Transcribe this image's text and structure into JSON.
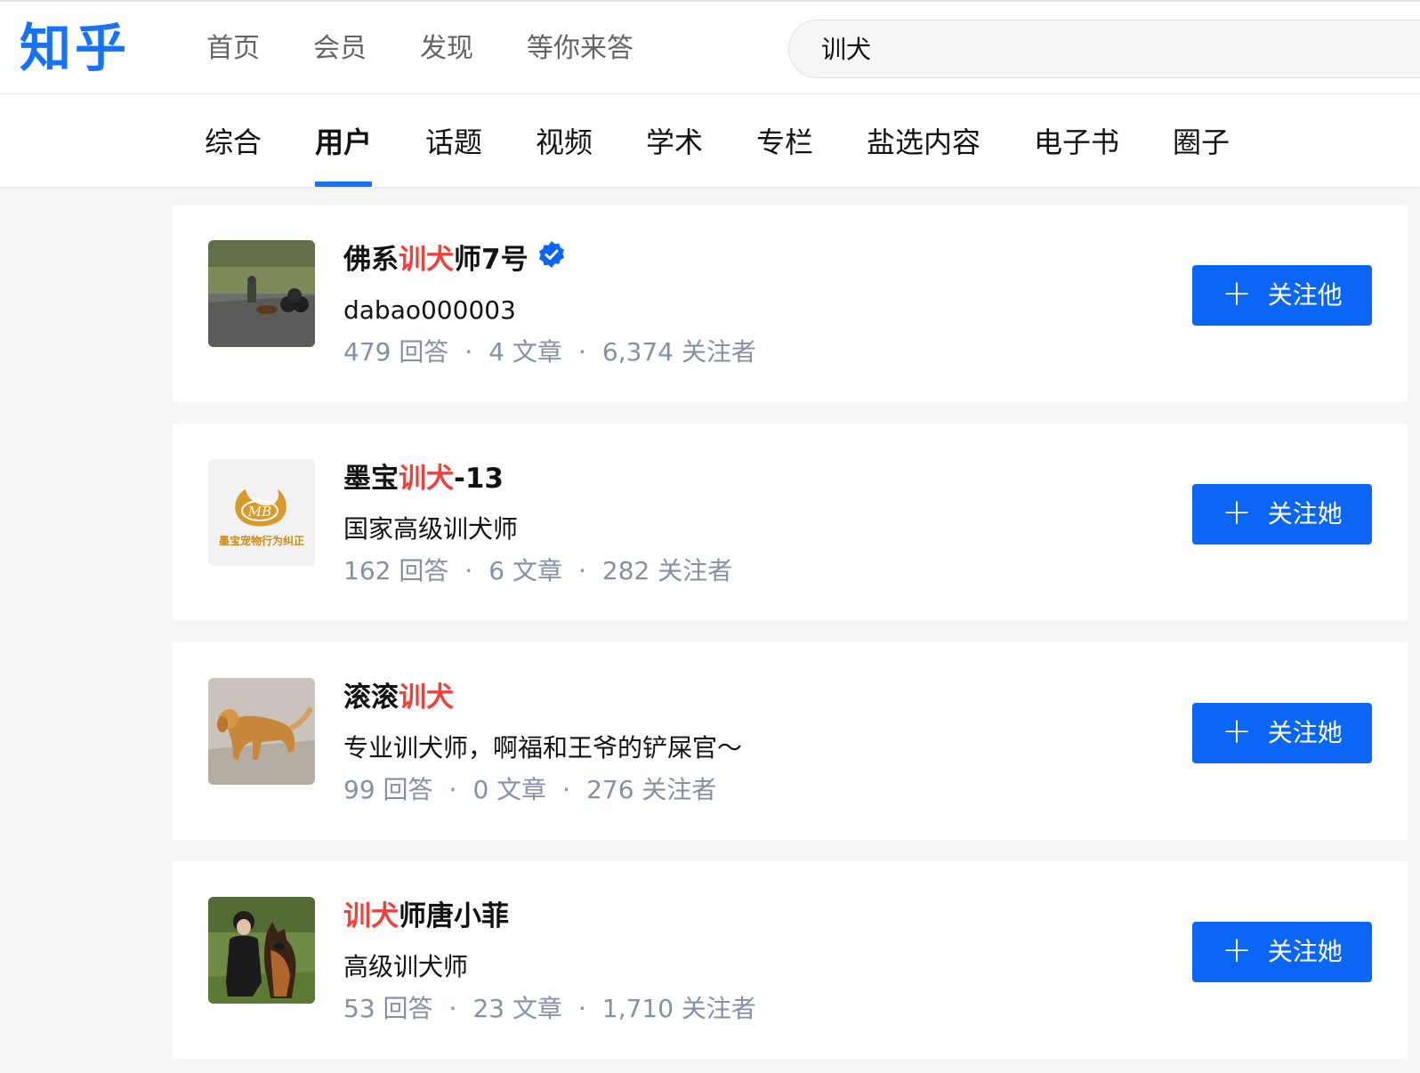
{
  "header": {
    "logo": "知乎",
    "nav": [
      "首页",
      "会员",
      "发现",
      "等你来答"
    ],
    "search_value": "训犬"
  },
  "tabs": [
    "综合",
    "用户",
    "话题",
    "视频",
    "学术",
    "专栏",
    "盐选内容",
    "电子书",
    "圈子"
  ],
  "active_tab": "用户",
  "colors": {
    "brand": "#1772f6",
    "highlight": "#f1403c",
    "button": "#0c66f5",
    "meta": "#8590a6"
  },
  "users": [
    {
      "name_parts": [
        "佛系",
        "训犬",
        "师7号"
      ],
      "verified": true,
      "bio": "dabao000003",
      "answers": "479 回答",
      "articles": "4 文章",
      "followers": "6,374 关注者",
      "button": "关注他"
    },
    {
      "name_parts": [
        "墨宝",
        "训犬",
        "-13"
      ],
      "verified": false,
      "bio": "国家高级训犬师",
      "avatar_text": "墨宝宠物行为纠正",
      "avatar_logo": "MB",
      "answers": "162 回答",
      "articles": "6 文章",
      "followers": "282 关注者",
      "button": "关注她"
    },
    {
      "name_parts": [
        "滚滚",
        "训犬",
        ""
      ],
      "verified": false,
      "bio": "专业训犬师，啊福和王爷的铲屎官～",
      "answers": "99 回答",
      "articles": "0 文章",
      "followers": "276 关注者",
      "button": "关注她"
    },
    {
      "name_parts": [
        "",
        "训犬",
        "师唐小菲"
      ],
      "verified": false,
      "bio": "高级训犬师",
      "answers": "53 回答",
      "articles": "23 文章",
      "followers": "1,710 关注者",
      "button": "关注她"
    }
  ]
}
